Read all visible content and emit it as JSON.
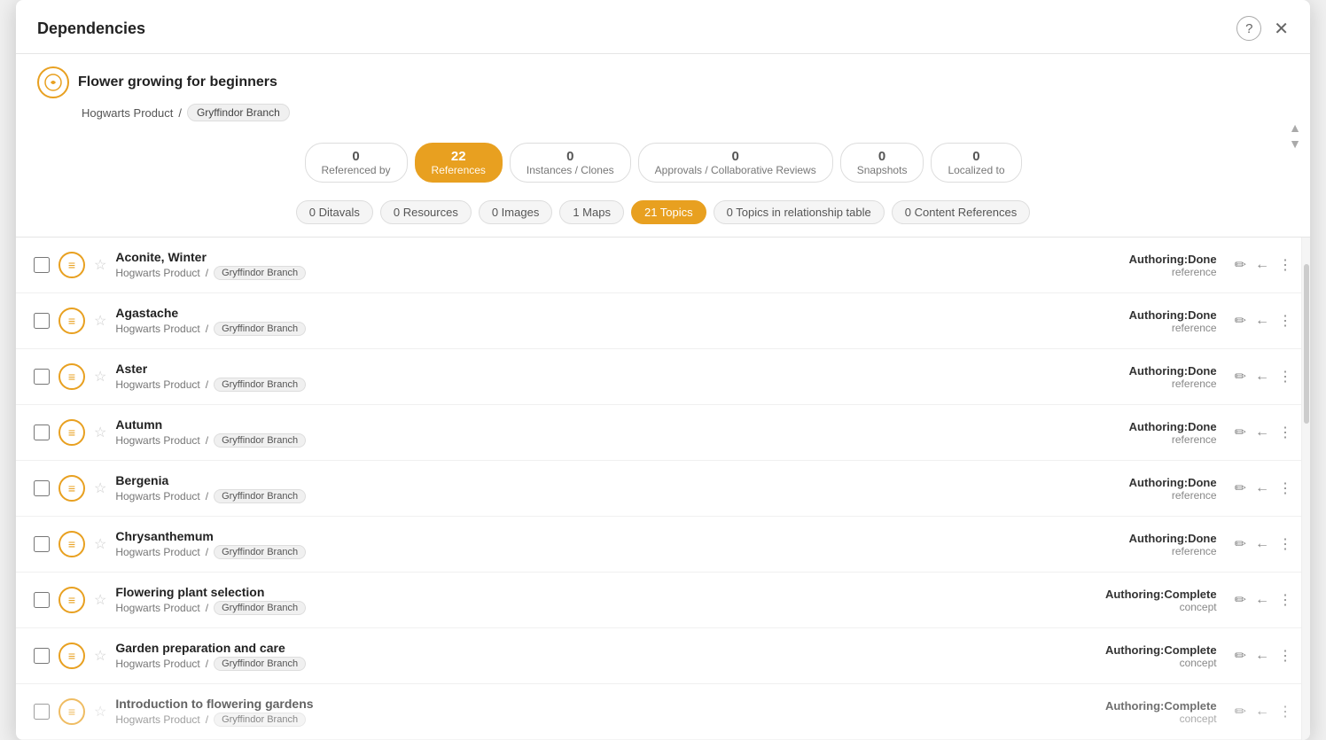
{
  "modal": {
    "title": "Dependencies",
    "help_icon": "?",
    "close_icon": "✕"
  },
  "topic": {
    "title": "Flower growing for beginners",
    "breadcrumb_product": "Hogwarts Product",
    "breadcrumb_branch": "Gryffindor Branch"
  },
  "tabs": [
    {
      "count": "0",
      "label": "Referenced by"
    },
    {
      "count": "22",
      "label": "References",
      "active": true
    },
    {
      "count": "0",
      "label": "Instances / Clones"
    },
    {
      "count": "0",
      "label": "Approvals / Collaborative Reviews"
    },
    {
      "count": "0",
      "label": "Snapshots"
    },
    {
      "count": "0",
      "label": "Localized to"
    }
  ],
  "subtabs": [
    {
      "label": "0 Ditavals"
    },
    {
      "label": "0 Resources"
    },
    {
      "label": "0 Images"
    },
    {
      "label": "1 Maps"
    },
    {
      "label": "21 Topics",
      "active": true
    },
    {
      "label": "0 Topics in relationship table"
    },
    {
      "label": "0 Content References"
    }
  ],
  "items": [
    {
      "name": "Aconite, Winter",
      "product": "Hogwarts Product",
      "branch": "Gryffindor Branch",
      "status": "Authoring:Done",
      "type": "reference"
    },
    {
      "name": "Agastache",
      "product": "Hogwarts Product",
      "branch": "Gryffindor Branch",
      "status": "Authoring:Done",
      "type": "reference"
    },
    {
      "name": "Aster",
      "product": "Hogwarts Product",
      "branch": "Gryffindor Branch",
      "status": "Authoring:Done",
      "type": "reference"
    },
    {
      "name": "Autumn",
      "product": "Hogwarts Product",
      "branch": "Gryffindor Branch",
      "status": "Authoring:Done",
      "type": "reference"
    },
    {
      "name": "Bergenia",
      "product": "Hogwarts Product",
      "branch": "Gryffindor Branch",
      "status": "Authoring:Done",
      "type": "reference"
    },
    {
      "name": "Chrysanthemum",
      "product": "Hogwarts Product",
      "branch": "Gryffindor Branch",
      "status": "Authoring:Done",
      "type": "reference"
    },
    {
      "name": "Flowering plant selection",
      "product": "Hogwarts Product",
      "branch": "Gryffindor Branch",
      "status": "Authoring:Complete",
      "type": "concept"
    },
    {
      "name": "Garden preparation and care",
      "product": "Hogwarts Product",
      "branch": "Gryffindor Branch",
      "status": "Authoring:Complete",
      "type": "concept"
    },
    {
      "name": "Introduction to flowering gardens",
      "product": "Hogwarts Product",
      "branch": "Gryffindor Branch",
      "status": "Authoring:Complete",
      "type": "concept"
    }
  ],
  "icons": {
    "topic": "⟳",
    "doc": "≡",
    "star": "☆",
    "edit": "✏",
    "back": "←",
    "more": "⋮",
    "scroll_up": "▲",
    "scroll_down": "▼"
  }
}
